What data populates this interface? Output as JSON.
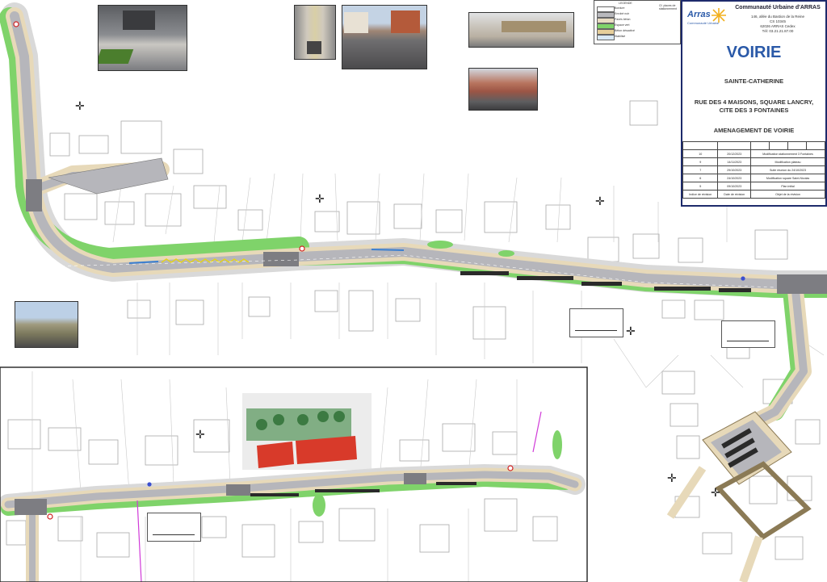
{
  "cartouche": {
    "organisation": "Communauté Urbaine d'ARRAS",
    "address_lines": [
      "146, allée du Bastion de la Reine",
      "CS 10345",
      "62026 ARRAS Cedex",
      "Tél: 03.21.21.87.00"
    ],
    "logo_text": "Arras",
    "logo_subtext": "Communauté Urbaine",
    "title": "VOIRIE",
    "commune": "SAINTE-CATHERINE",
    "streets": "RUE DES 4 MAISONS, SQUARE LANCRY, CITE DES 3 FONTAINES",
    "subject": "AMENAGEMENT DE VOIRIE",
    "revisions": [
      {
        "index": "10",
        "date": "20/12/2023",
        "label": "Modification stationnement 3 Fontaines"
      },
      {
        "index": "9",
        "date": "14/11/2023",
        "label": "Modification plateau"
      },
      {
        "index": "7",
        "date": "29/10/2023",
        "label": "Suite réunion du 24/10/2023"
      },
      {
        "index": "6",
        "date": "24/10/2023",
        "label": "Modification square Saint-Nicolas"
      },
      {
        "index": "5",
        "date": "09/10/2023",
        "label": "Plan initial"
      }
    ],
    "revision_footer": [
      "Indice de révision",
      "Date de révision",
      "Objet de la révision"
    ]
  },
  "legend": {
    "header": "LEGENDE",
    "items": [
      {
        "label": "Bordure",
        "color": "#ffffff"
      },
      {
        "label": "Enrobé noir",
        "color": "#b9b9bd"
      },
      {
        "label": "Pavés béton",
        "color": "#e9dcc2"
      },
      {
        "label": "Espace vert",
        "color": "#7fd36a"
      },
      {
        "label": "Béton désactivé",
        "color": "#e6cf9a"
      },
      {
        "label": "Stabilisé",
        "color": "#d8e8f4"
      }
    ],
    "right_text": "Cf. places de stationnement"
  },
  "colors": {
    "road": "#b6b6bb",
    "pavement": "#e7d9b9",
    "green": "#7fd36a",
    "building_outline": "#a8a8a8",
    "border_blue": "#1d2a6b",
    "parking_bay": "#2a2a2a"
  },
  "photos": [
    {
      "name": "photo-street-pavement",
      "icon": "photo-icon"
    },
    {
      "name": "photo-paved-strip",
      "icon": "photo-icon"
    },
    {
      "name": "photo-houses-street",
      "icon": "photo-icon"
    },
    {
      "name": "photo-planter-wall",
      "icon": "photo-icon"
    },
    {
      "name": "photo-low-wall",
      "icon": "photo-icon"
    },
    {
      "name": "photo-field-path",
      "icon": "photo-icon"
    }
  ]
}
